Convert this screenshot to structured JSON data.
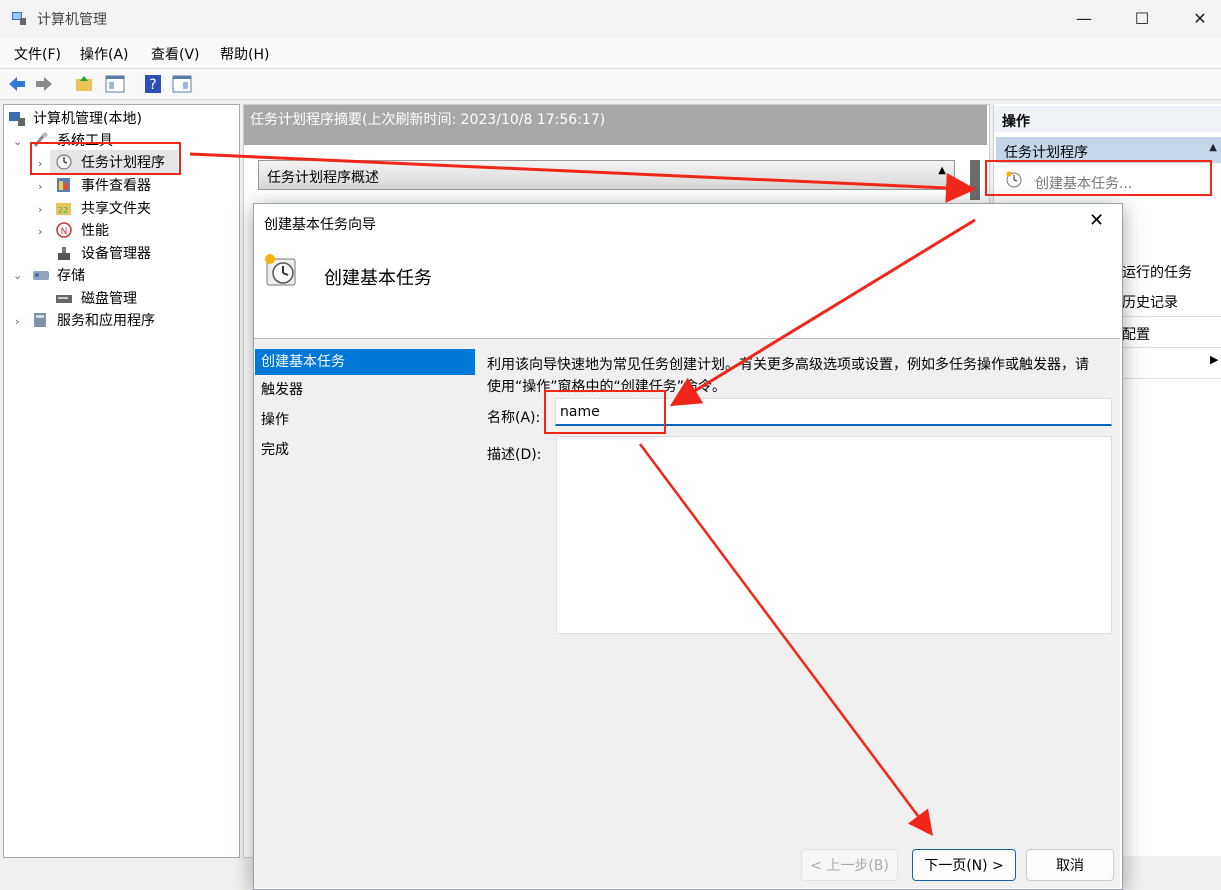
{
  "window": {
    "title": "计算机管理",
    "minimize": "—",
    "maximize": "☐",
    "close": "✕"
  },
  "menu": [
    "文件(F)",
    "操作(A)",
    "查看(V)",
    "帮助(H)"
  ],
  "tree": {
    "root": "计算机管理(本地)",
    "system_tools": "系统工具",
    "task_scheduler": "任务计划程序",
    "event_viewer": "事件查看器",
    "shared_folders": "共享文件夹",
    "performance": "性能",
    "device_manager": "设备管理器",
    "storage": "存储",
    "disk_management": "磁盘管理",
    "services_apps": "服务和应用程序"
  },
  "middle": {
    "header": "任务计划程序摘要(上次刷新时间: 2023/10/8 17:56:17)",
    "overview": "任务计划程序概述"
  },
  "right": {
    "title": "操作",
    "section": "任务计划程序",
    "create_basic_task": "创建基本任务...",
    "partial_1": "运行的任务",
    "partial_2": "历史记录",
    "partial_3": "配置"
  },
  "dialog": {
    "title": "创建基本任务向导",
    "close": "✕",
    "header_title": "创建基本任务",
    "steps": [
      "创建基本任务",
      "触发器",
      "操作",
      "完成"
    ],
    "intro": "利用该向导快速地为常见任务创建计划。有关更多高级选项或设置，例如多任务操作或触发器，请使用“操作”窗格中的“创建任务”命令。",
    "name_label": "名称(A):",
    "name_value": "name",
    "desc_label": "描述(D):",
    "back_button": "< 上一步(B)",
    "next_button": "下一页(N) >",
    "cancel_button": "取消"
  },
  "colors": {
    "accent": "#0078d7",
    "annotation_red": "#f0261b"
  }
}
